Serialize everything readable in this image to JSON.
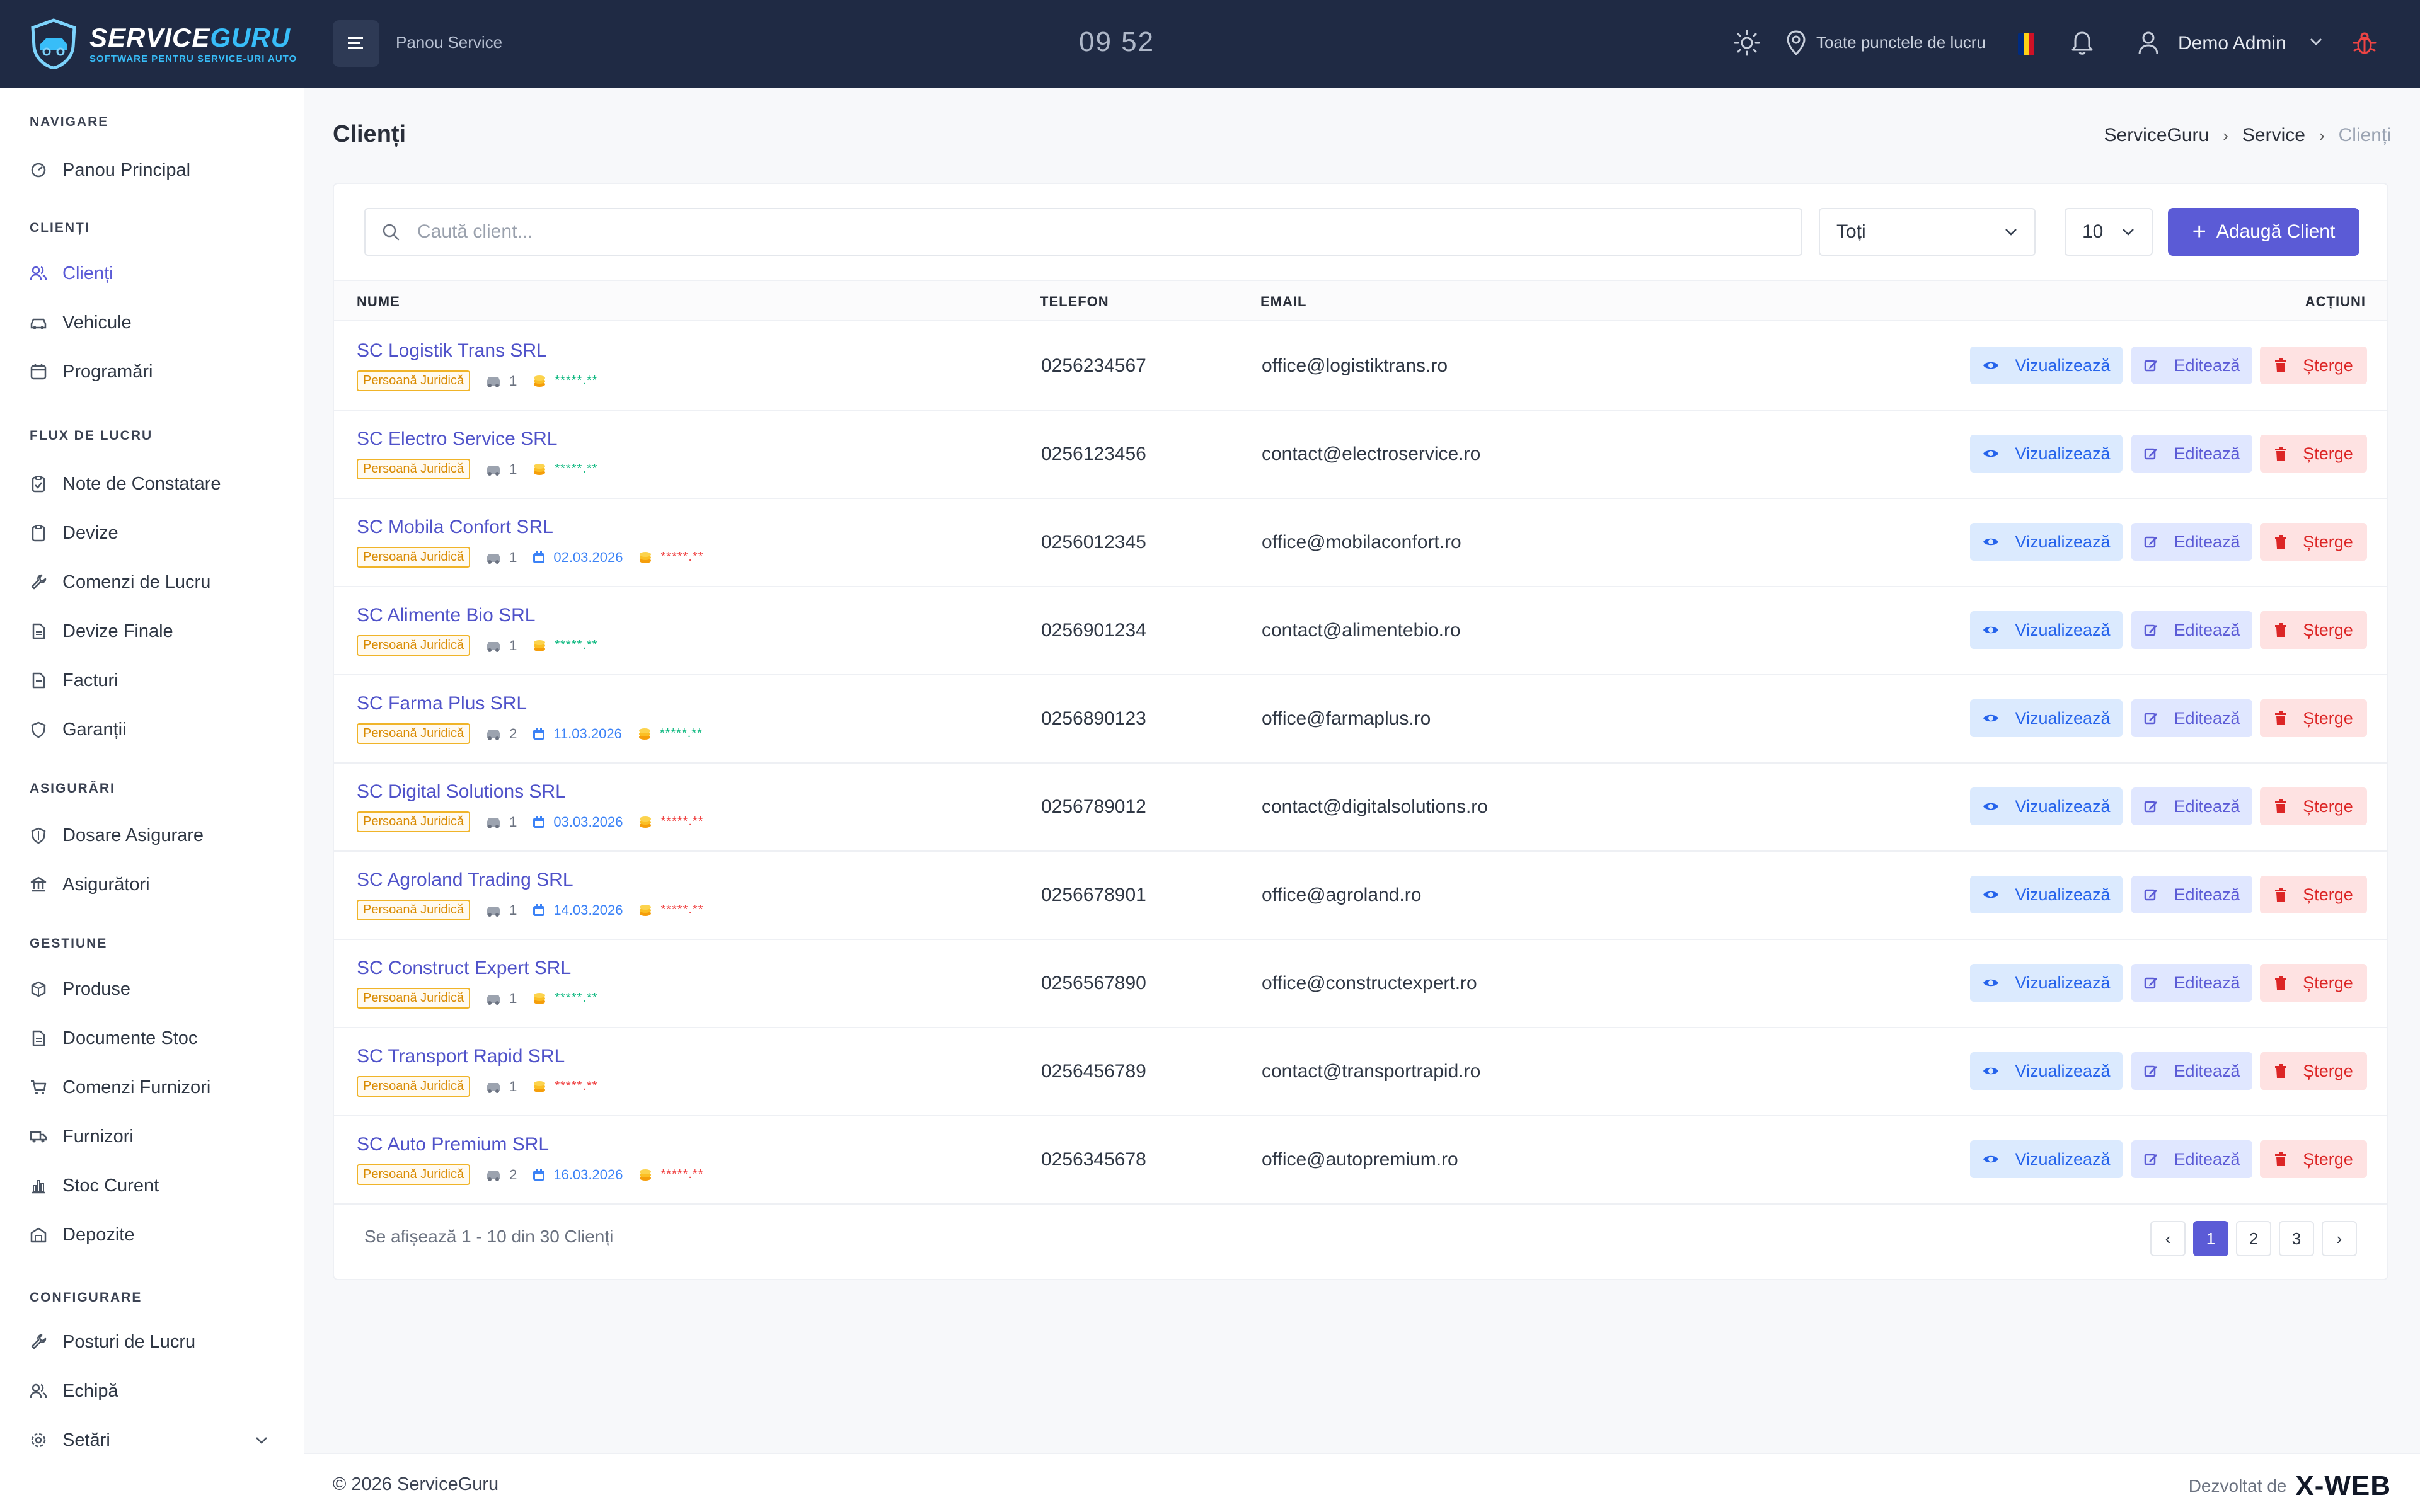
{
  "header": {
    "logo_title": "SERVICE",
    "logo_title_accent": "GURU",
    "logo_subtitle": "SOFTWARE PENTRU SERVICE-URI AUTO",
    "panel_label": "Panou Service",
    "clock": "09 52",
    "location_label": "Toate punctele de lucru",
    "user_name": "Demo Admin"
  },
  "sidebar": {
    "sections": [
      {
        "title": "NAVIGARE",
        "items": [
          {
            "label": "Panou Principal",
            "icon": "dashboard-icon"
          }
        ]
      },
      {
        "title": "CLIENȚI",
        "items": [
          {
            "label": "Clienți",
            "icon": "users-icon",
            "active": true
          },
          {
            "label": "Vehicule",
            "icon": "car-icon"
          },
          {
            "label": "Programări",
            "icon": "calendar-icon"
          }
        ]
      },
      {
        "title": "FLUX DE LUCRU",
        "items": [
          {
            "label": "Note de Constatare",
            "icon": "clipboard-icon"
          },
          {
            "label": "Devize",
            "icon": "clipboard-icon"
          },
          {
            "label": "Comenzi de Lucru",
            "icon": "wrench-icon"
          },
          {
            "label": "Devize Finale",
            "icon": "document-icon"
          },
          {
            "label": "Facturi",
            "icon": "document-icon"
          },
          {
            "label": "Garanții",
            "icon": "shield-icon"
          }
        ]
      },
      {
        "title": "ASIGURĂRI",
        "items": [
          {
            "label": "Dosare Asigurare",
            "icon": "shield-icon"
          },
          {
            "label": "Asigurători",
            "icon": "bank-icon"
          }
        ]
      },
      {
        "title": "GESTIUNE",
        "items": [
          {
            "label": "Produse",
            "icon": "box-icon"
          },
          {
            "label": "Documente Stoc",
            "icon": "document-icon"
          },
          {
            "label": "Comenzi Furnizori",
            "icon": "cart-icon"
          },
          {
            "label": "Furnizori",
            "icon": "truck-icon"
          },
          {
            "label": "Stoc Curent",
            "icon": "bar-chart-icon"
          },
          {
            "label": "Depozite",
            "icon": "warehouse-icon"
          }
        ]
      },
      {
        "title": "CONFIGURARE",
        "items": [
          {
            "label": "Posturi de Lucru",
            "icon": "wrench-icon"
          },
          {
            "label": "Echipă",
            "icon": "users-icon"
          },
          {
            "label": "Setări",
            "icon": "gear-icon"
          }
        ]
      }
    ]
  },
  "page": {
    "title": "Clienți",
    "breadcrumb": [
      "ServiceGuru",
      "Service",
      "Clienți"
    ]
  },
  "toolbar": {
    "search_placeholder": "Caută client...",
    "filter_value": "Toți",
    "per_page_value": "10",
    "add_button": "Adaugă Client"
  },
  "table": {
    "headers": {
      "name": "NUME",
      "phone": "TELEFON",
      "email": "EMAIL",
      "actions": "ACȚIUNI"
    },
    "action_labels": {
      "view": "Vizualizează",
      "edit": "Editează",
      "delete": "Șterge"
    },
    "badge_label": "Persoană Juridică",
    "rows": [
      {
        "name": "SC Logistik Trans SRL",
        "vehicles": "1",
        "date": "",
        "rating": "*****.**",
        "rating_color": "green",
        "phone": "0256234567",
        "email": "office@logistiktrans.ro"
      },
      {
        "name": "SC Electro Service SRL",
        "vehicles": "1",
        "date": "",
        "rating": "*****.**",
        "rating_color": "green",
        "phone": "0256123456",
        "email": "contact@electroservice.ro"
      },
      {
        "name": "SC Mobila Confort SRL",
        "vehicles": "1",
        "date": "02.03.2026",
        "rating": "*****.**",
        "rating_color": "red",
        "phone": "0256012345",
        "email": "office@mobilaconfort.ro"
      },
      {
        "name": "SC Alimente Bio SRL",
        "vehicles": "1",
        "date": "",
        "rating": "*****.**",
        "rating_color": "green",
        "phone": "0256901234",
        "email": "contact@alimentebio.ro"
      },
      {
        "name": "SC Farma Plus SRL",
        "vehicles": "2",
        "date": "11.03.2026",
        "rating": "*****.**",
        "rating_color": "green",
        "phone": "0256890123",
        "email": "office@farmaplus.ro"
      },
      {
        "name": "SC Digital Solutions SRL",
        "vehicles": "1",
        "date": "03.03.2026",
        "rating": "*****.**",
        "rating_color": "red",
        "phone": "0256789012",
        "email": "contact@digitalsolutions.ro"
      },
      {
        "name": "SC Agroland Trading SRL",
        "vehicles": "1",
        "date": "14.03.2026",
        "rating": "*****.**",
        "rating_color": "red",
        "phone": "0256678901",
        "email": "office@agroland.ro"
      },
      {
        "name": "SC Construct Expert SRL",
        "vehicles": "1",
        "date": "",
        "rating": "*****.**",
        "rating_color": "green",
        "phone": "0256567890",
        "email": "office@constructexpert.ro"
      },
      {
        "name": "SC Transport Rapid SRL",
        "vehicles": "1",
        "date": "",
        "rating": "*****.**",
        "rating_color": "red",
        "phone": "0256456789",
        "email": "contact@transportrapid.ro"
      },
      {
        "name": "SC Auto Premium SRL",
        "vehicles": "2",
        "date": "16.03.2026",
        "rating": "*****.**",
        "rating_color": "red",
        "phone": "0256345678",
        "email": "office@autopremium.ro"
      }
    ]
  },
  "pagination": {
    "info": "Se afișează 1 - 10 din 30 Clienți",
    "prev": "‹",
    "next": "›",
    "pages": [
      "1",
      "2",
      "3"
    ],
    "current": "1"
  },
  "footer": {
    "copyright": "© 2026 ServiceGuru",
    "developed_by": "Dezvoltat de",
    "brand": "X-WEB"
  },
  "colors": {
    "topbar": "#1f2a44",
    "accent": "#5b5bd6",
    "view": "#2563eb",
    "delete": "#dc2626",
    "rating_green": "#10b981",
    "rating_red": "#ef4444"
  }
}
